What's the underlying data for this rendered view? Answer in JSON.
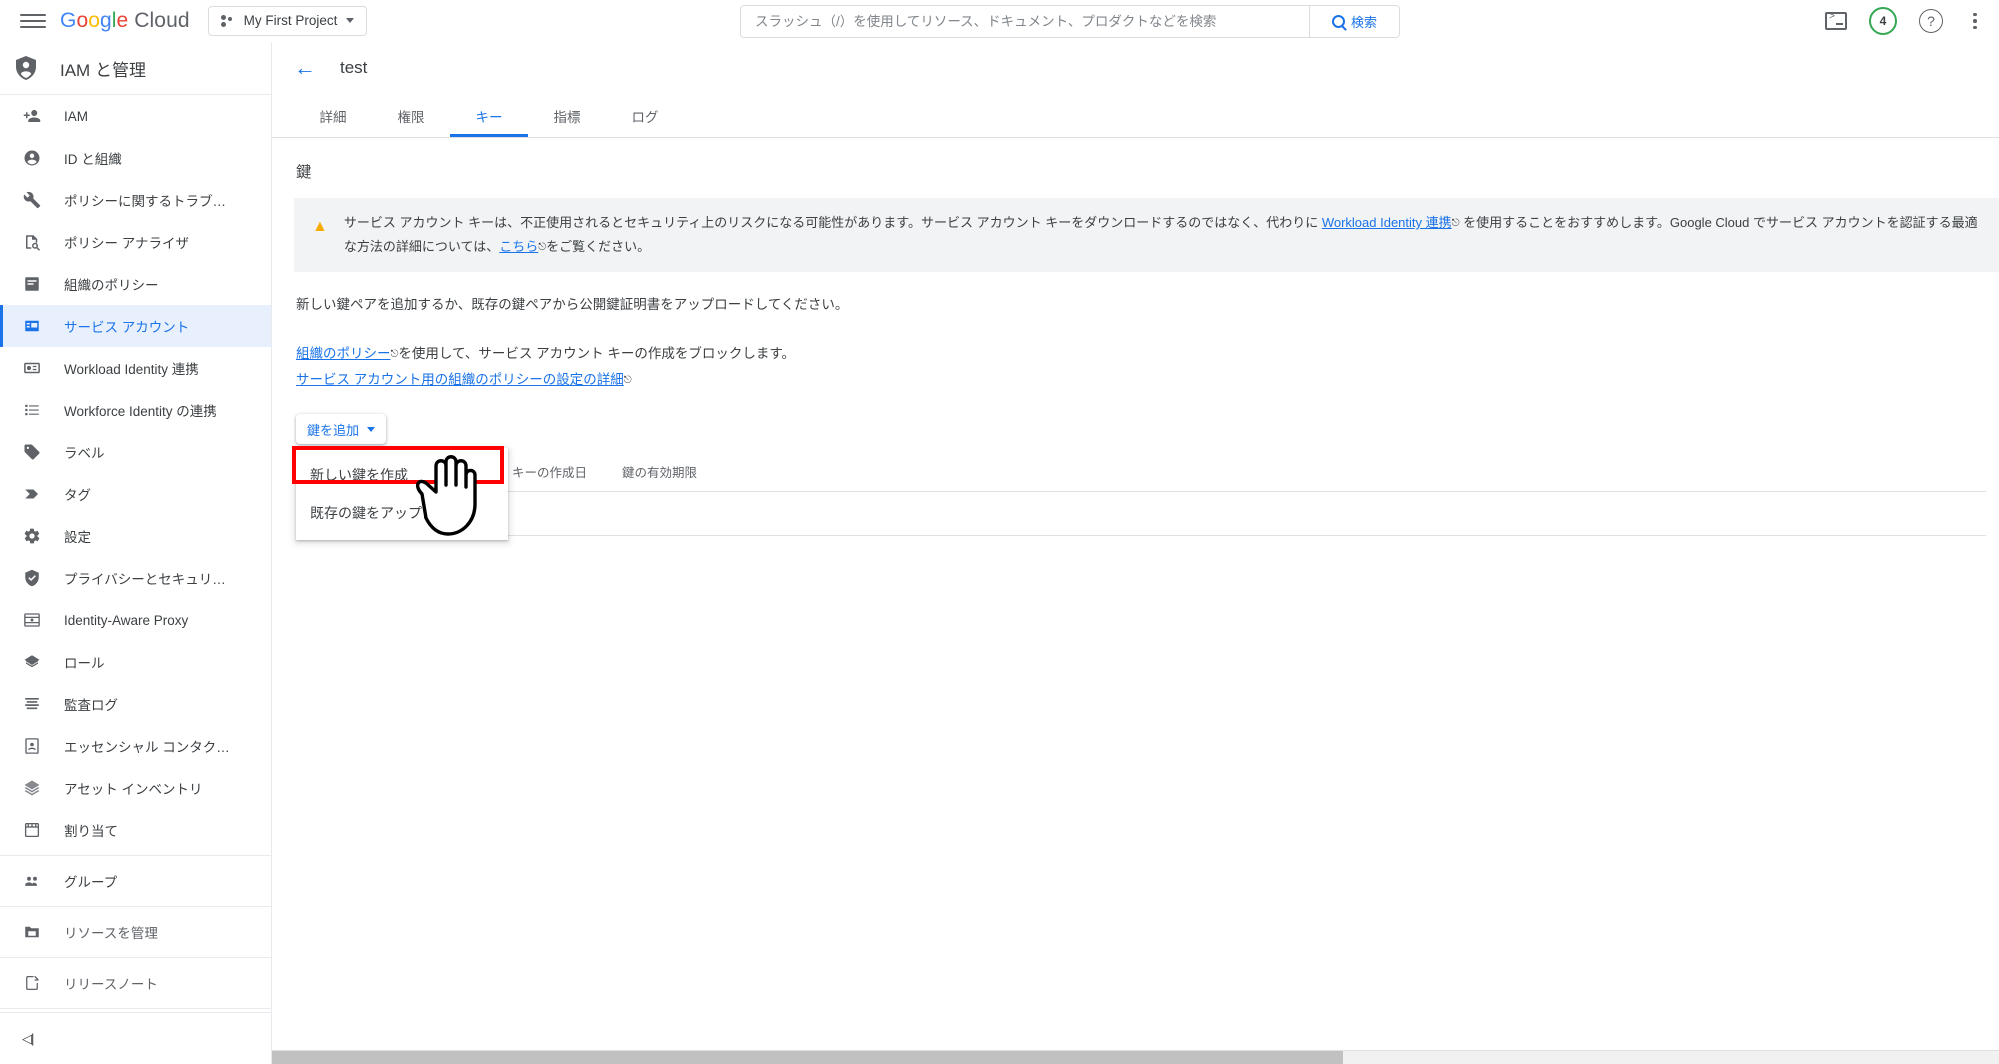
{
  "header": {
    "menu_icon": "hamburger-icon",
    "logo": {
      "google": "Google",
      "cloud": "Cloud"
    },
    "project": {
      "name": "My First Project",
      "icon": "project-dots-icon"
    },
    "search": {
      "placeholder": "スラッシュ（/）を使用してリソース、ドキュメント、プロダクトなどを検索",
      "value": "",
      "button_label": "検索",
      "button_icon": "search-icon"
    },
    "actions": {
      "cloud_shell_icon": "terminal-icon",
      "notifications_count": "4",
      "help_icon": "help-circle-icon",
      "more_icon": "kebab-menu-icon"
    }
  },
  "sidebar": {
    "title": "IAM と管理",
    "title_icon": "shield-person-icon",
    "items": [
      {
        "label": "IAM",
        "icon": "person-add-icon",
        "active": false
      },
      {
        "label": "ID と組織",
        "icon": "account-circle-icon",
        "active": false
      },
      {
        "label": "ポリシーに関するトラブ…",
        "icon": "wrench-icon",
        "active": false
      },
      {
        "label": "ポリシー アナライザ",
        "icon": "document-search-icon",
        "active": false
      },
      {
        "label": "組織のポリシー",
        "icon": "policy-board-icon",
        "active": false
      },
      {
        "label": "サービス アカウント",
        "icon": "service-account-icon",
        "active": true
      },
      {
        "label": "Workload Identity 連携",
        "icon": "badge-icon",
        "active": false
      },
      {
        "label": "Workforce Identity の連携",
        "icon": "list-icon",
        "active": false
      },
      {
        "label": "ラベル",
        "icon": "label-icon",
        "active": false
      },
      {
        "label": "タグ",
        "icon": "tag-icon",
        "active": false
      },
      {
        "label": "設定",
        "icon": "gear-icon",
        "active": false
      },
      {
        "label": "プライバシーとセキュリ…",
        "icon": "shield-check-icon",
        "active": false
      },
      {
        "label": "Identity-Aware Proxy",
        "icon": "proxy-icon",
        "active": false
      },
      {
        "label": "ロール",
        "icon": "roles-icon",
        "active": false
      },
      {
        "label": "監査ログ",
        "icon": "audit-log-icon",
        "active": false
      },
      {
        "label": "エッセンシャル コンタク…",
        "icon": "contacts-icon",
        "active": false
      },
      {
        "label": "アセット インベントリ",
        "icon": "asset-inventory-icon",
        "active": false
      },
      {
        "label": "割り当て",
        "icon": "quota-icon",
        "active": false
      }
    ],
    "items_group2": [
      {
        "label": "グループ",
        "icon": "groups-icon"
      },
      {
        "label": "リソースを管理",
        "icon": "manage-resources-icon"
      }
    ],
    "items_group3": [
      {
        "label": "リリースノート",
        "icon": "release-notes-icon"
      }
    ],
    "collapse_label": "◁|",
    "collapse_icon": "collapse-sidebar-icon"
  },
  "main": {
    "back_icon": "back-arrow-icon",
    "page_title": "test",
    "tabs": [
      {
        "label": "詳細",
        "active": false
      },
      {
        "label": "権限",
        "active": false
      },
      {
        "label": "キー",
        "active": true
      },
      {
        "label": "指標",
        "active": false
      },
      {
        "label": "ログ",
        "active": false
      }
    ],
    "section_title": "鍵",
    "warning": {
      "icon": "warning-triangle-icon",
      "text_part1": "サービス アカウント キーは、不正使用されるとセキュリティ上のリスクになる可能性があります。サービス アカウント キーをダウンロードするのではなく、代わりに ",
      "link1": "Workload Identity 連携",
      "text_part2": " を使用することをおすすめします。Google Cloud でサービス アカウントを認証する最適な方法の詳細については、",
      "link2": "こちら",
      "text_part3": "をご覧ください。"
    },
    "body_text": "新しい鍵ペアを追加するか、既存の鍵ペアから公開鍵証明書をアップロードしてください。",
    "links": {
      "org_policy_link": "組織のポリシー",
      "org_policy_rest": "を使用して、サービス アカウント キーの作成をブロックします。",
      "sa_org_policy_link": "サービス アカウント用の組織のポリシーの設定の詳細"
    },
    "add_key_button": "鍵を追加",
    "add_key_icon": "chevron-down-icon",
    "menu_items": [
      {
        "label": "新しい鍵を作成",
        "highlighted": true
      },
      {
        "label": "既存の鍵をアップロード",
        "highlighted": false
      }
    ],
    "table": {
      "columns": [
        "キーの作成日",
        "鍵の有効期限"
      ],
      "rows": []
    }
  },
  "colors": {
    "accent_blue": "#1a73e8",
    "highlight_red": "#ff0000",
    "warn_amber": "#f9ab00",
    "active_bg": "#e8f0fe",
    "banner_bg": "#f1f3f4"
  }
}
